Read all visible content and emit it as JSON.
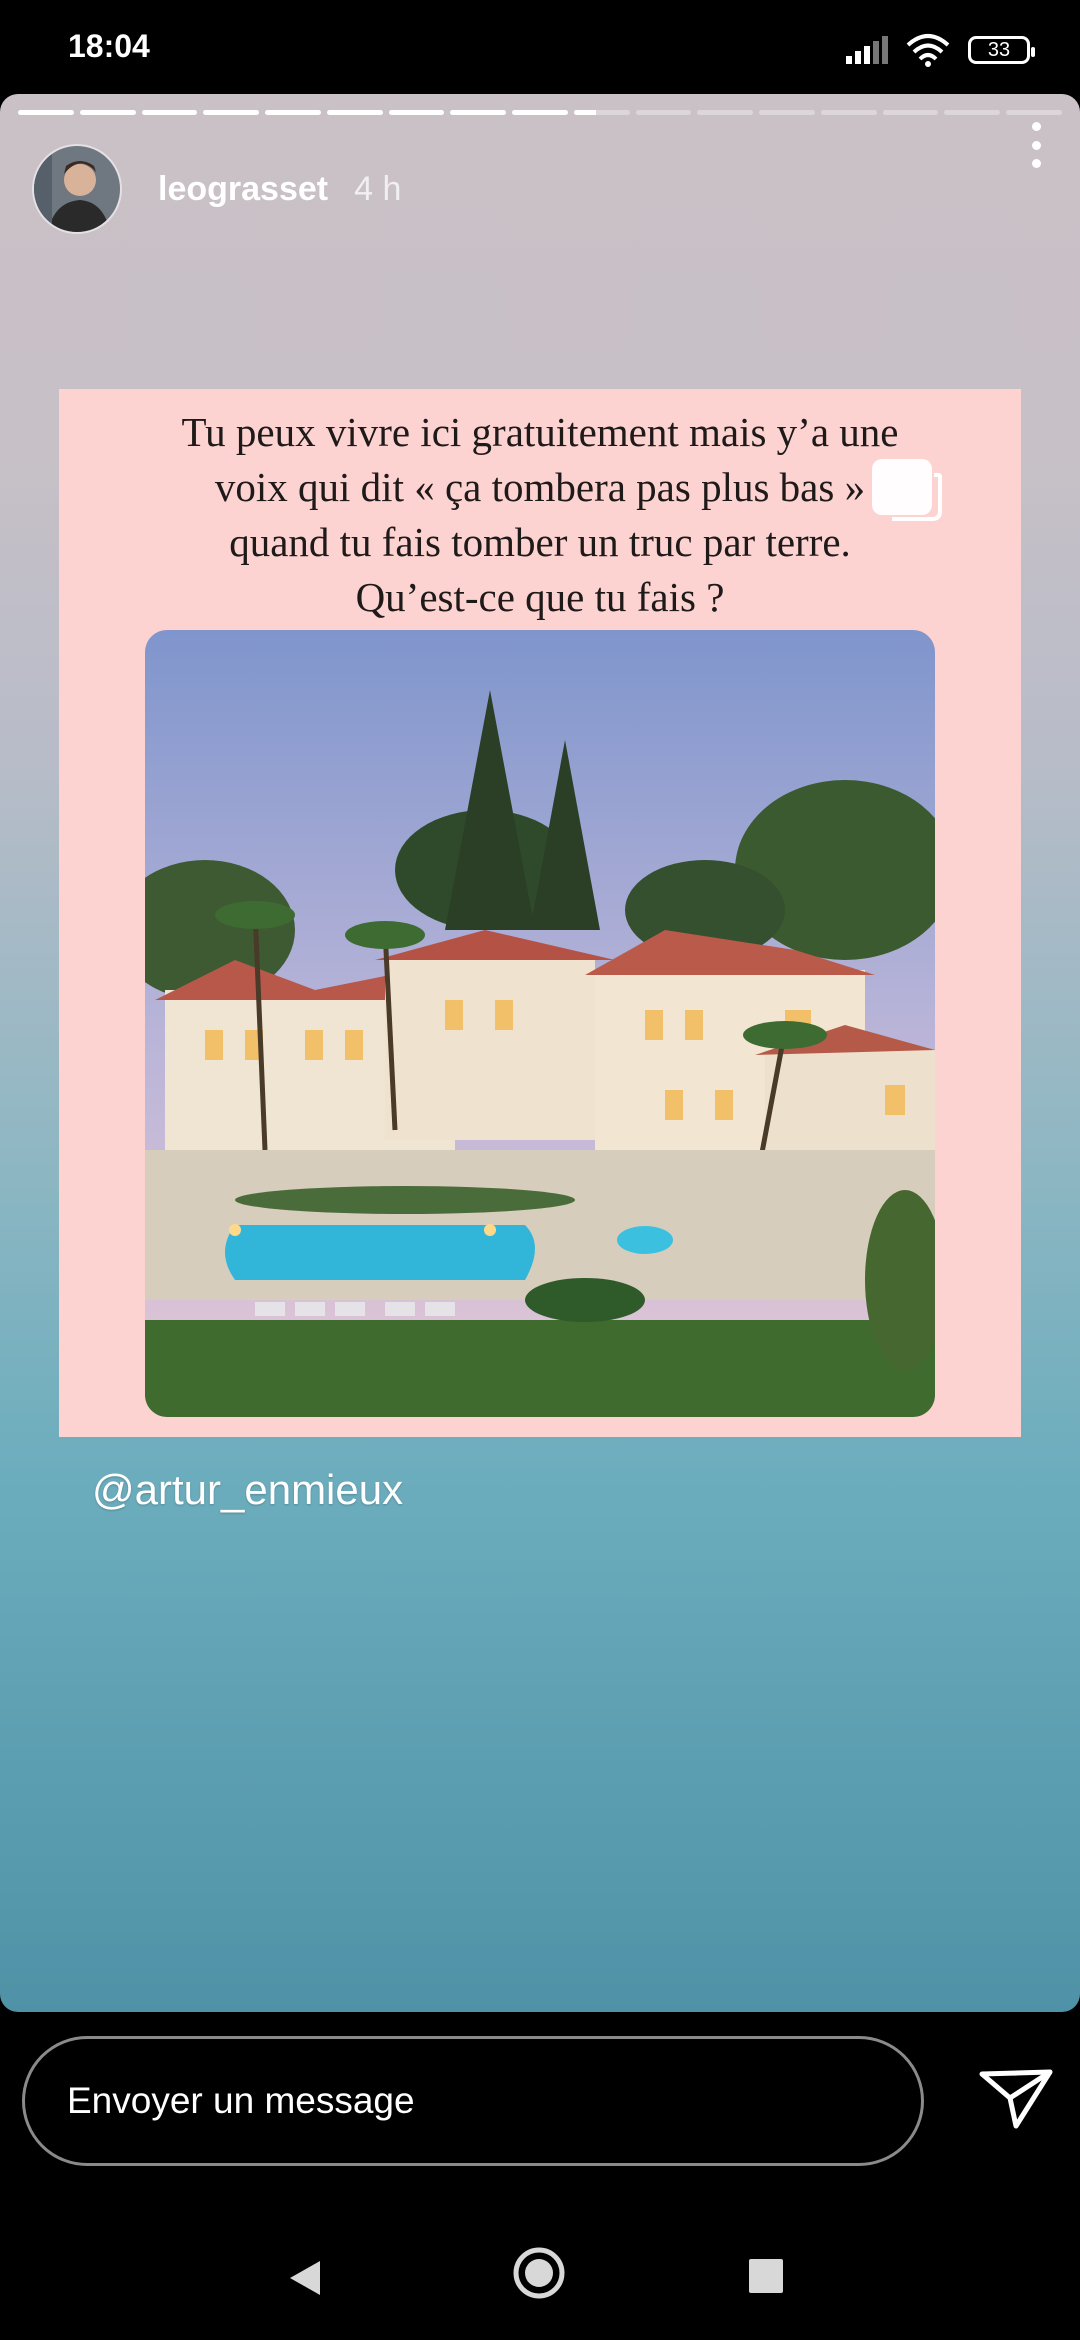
{
  "status_bar": {
    "time": "18:04",
    "battery": "33"
  },
  "story": {
    "progress": {
      "segments": 17,
      "current_index": 9,
      "current_fraction": 0.4
    },
    "username": "leograsset",
    "timestamp": "4 h",
    "post_text_lines": [
      "Tu peux vivre ici gratuitement mais y’a une",
      "voix qui dit « ça tombera pas plus bas »",
      "quand tu fais tomber un truc par terre.",
      "Qu’est-ce que tu fais ?"
    ],
    "mention": "@artur_enmieux"
  },
  "reply": {
    "placeholder": "Envoyer un message"
  },
  "colors": {
    "card_background": "#fdd3d2",
    "story_gradient_top": "#c9c1c6",
    "story_gradient_bottom": "#4f92a7"
  },
  "icons": {
    "more": "more-vertical-icon",
    "send": "send-paper-plane-icon",
    "back": "nav-back-icon",
    "home": "nav-home-icon",
    "recent": "nav-recent-icon"
  }
}
